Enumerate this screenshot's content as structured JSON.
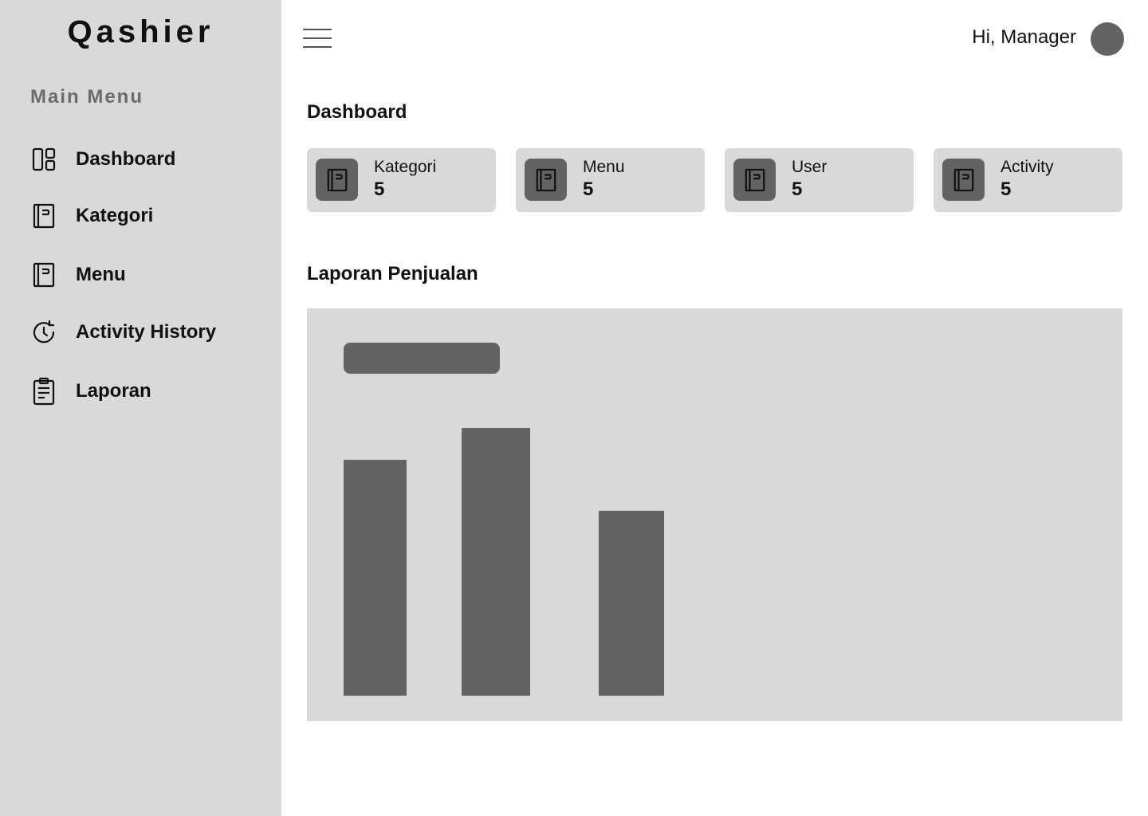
{
  "app": {
    "brand": "Qashier"
  },
  "sidebar": {
    "heading": "Main Menu",
    "items": [
      {
        "label": "Dashboard",
        "icon": "dashboard-icon"
      },
      {
        "label": "Kategori",
        "icon": "book-icon"
      },
      {
        "label": "Menu",
        "icon": "book-icon"
      },
      {
        "label": "Activity History",
        "icon": "history-icon"
      },
      {
        "label": "Laporan",
        "icon": "clipboard-icon"
      }
    ]
  },
  "header": {
    "greeting": "Hi, Manager",
    "menu_icon": "hamburger-icon",
    "avatar_color": "#646363"
  },
  "dashboard": {
    "title": "Dashboard",
    "stats": [
      {
        "label": "Kategori",
        "value": "5",
        "icon": "book-icon"
      },
      {
        "label": "Menu",
        "value": "5",
        "icon": "book-icon"
      },
      {
        "label": "User",
        "value": "5",
        "icon": "book-icon"
      },
      {
        "label": "Activity",
        "value": "5",
        "icon": "book-icon"
      }
    ]
  },
  "report": {
    "title": "Laporan Penjualan"
  },
  "chart_data": {
    "type": "bar",
    "categories": [
      "",
      "",
      ""
    ],
    "values": [
      0.88,
      1.0,
      0.69
    ],
    "ylim": [
      0,
      1
    ],
    "grid": false,
    "bar_color": "#646363"
  },
  "colors": {
    "sidebar_bg": "#d9d9d9",
    "card_bg": "#d9d9d9",
    "accent_dark": "#646363",
    "heading_muted": "#6b6b6b"
  }
}
